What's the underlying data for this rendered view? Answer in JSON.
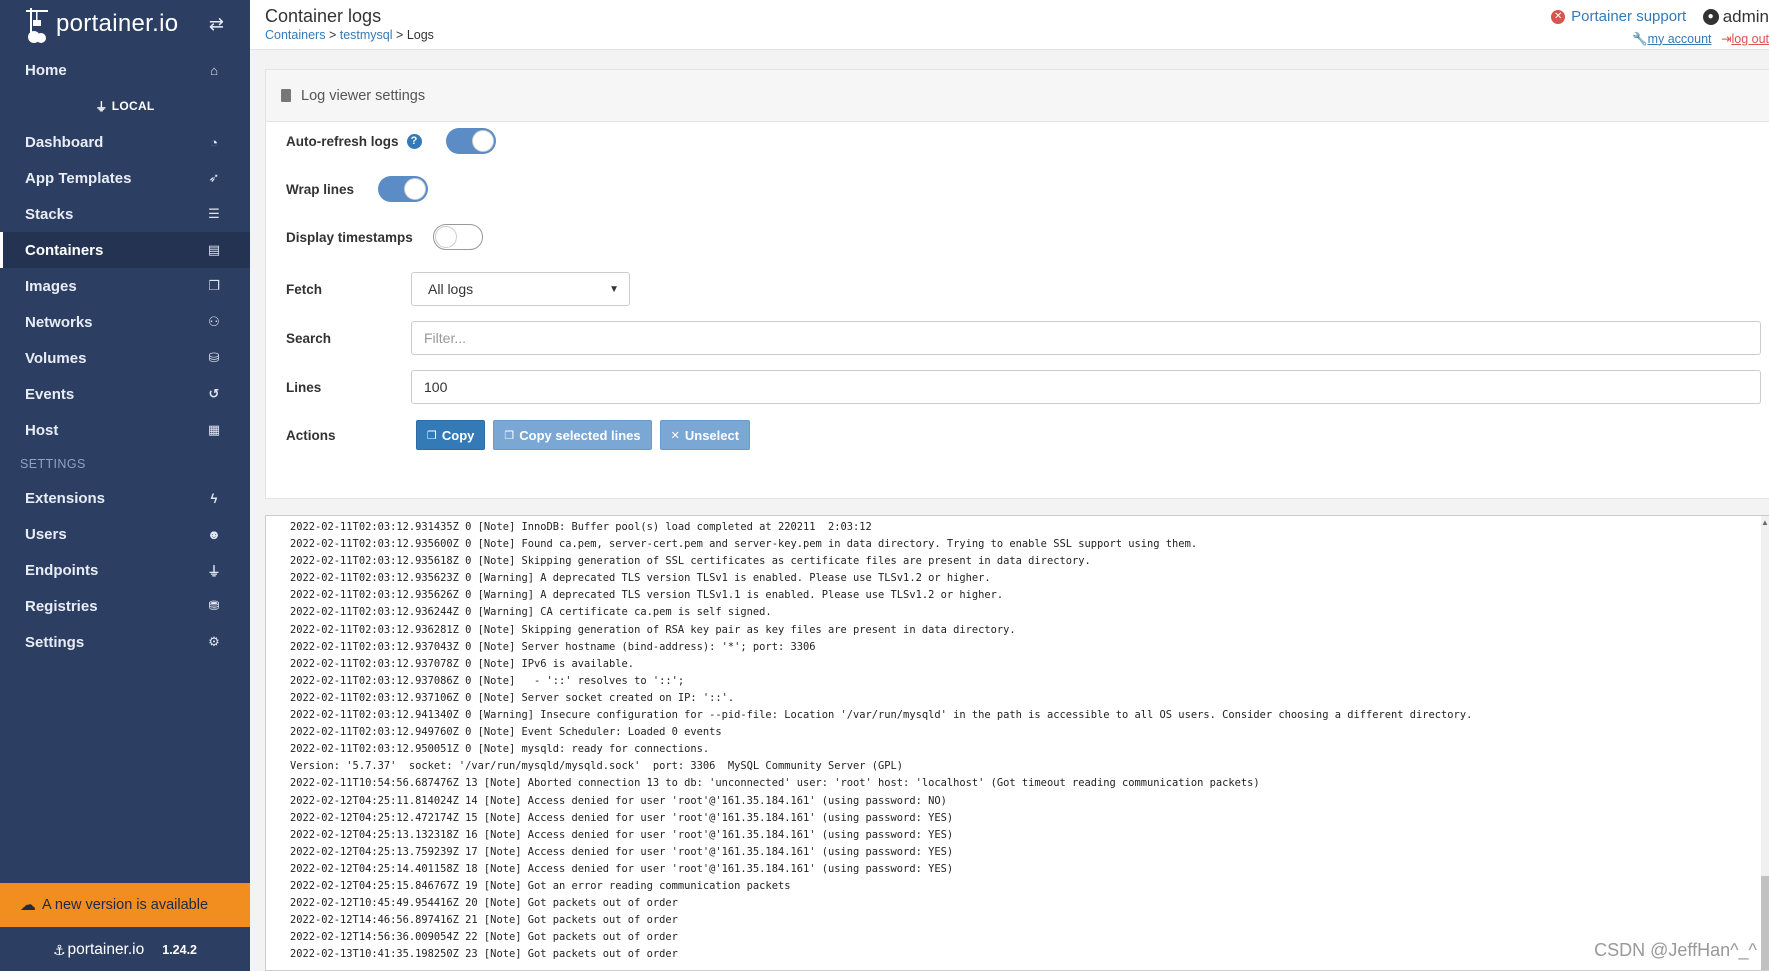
{
  "brand": {
    "name": "portainer.io",
    "version": "1.24.2"
  },
  "sidebar": {
    "home": "Home",
    "endpoint": "LOCAL",
    "items": [
      {
        "label": "Dashboard",
        "icon": "dashboard-icon"
      },
      {
        "label": "App Templates",
        "icon": "rocket-icon"
      },
      {
        "label": "Stacks",
        "icon": "list-icon"
      },
      {
        "label": "Containers",
        "icon": "server-icon"
      },
      {
        "label": "Images",
        "icon": "clone-icon"
      },
      {
        "label": "Networks",
        "icon": "sitemap-icon"
      },
      {
        "label": "Volumes",
        "icon": "cubes-icon"
      },
      {
        "label": "Events",
        "icon": "history-icon"
      },
      {
        "label": "Host",
        "icon": "th-icon"
      }
    ],
    "settings_header": "SETTINGS",
    "settings_items": [
      {
        "label": "Extensions",
        "icon": "bolt-icon"
      },
      {
        "label": "Users",
        "icon": "users-icon"
      },
      {
        "label": "Endpoints",
        "icon": "plug-icon"
      },
      {
        "label": "Registries",
        "icon": "database-icon"
      },
      {
        "label": "Settings",
        "icon": "cogs-icon"
      }
    ],
    "update_banner": "A new version is available"
  },
  "header": {
    "title": "Container logs",
    "breadcrumb": {
      "containers": "Containers",
      "container": "testmysql",
      "current": "Logs",
      "sep": ">"
    },
    "support": "Portainer support",
    "user": "admin",
    "my_account": "my account",
    "log_out": "log out"
  },
  "settings_panel": {
    "title": "Log viewer settings",
    "auto_refresh": {
      "label": "Auto-refresh logs",
      "on": true
    },
    "wrap_lines": {
      "label": "Wrap lines",
      "on": true
    },
    "timestamps": {
      "label": "Display timestamps",
      "on": false
    },
    "fetch": {
      "label": "Fetch",
      "value": "All logs"
    },
    "search": {
      "label": "Search",
      "placeholder": "Filter..."
    },
    "lines": {
      "label": "Lines",
      "value": "100"
    },
    "actions": {
      "label": "Actions",
      "copy": "Copy",
      "copy_selected": "Copy selected lines",
      "unselect": "Unselect"
    }
  },
  "logs": [
    "2022-02-11T02:03:12.931435Z 0 [Note] InnoDB: Buffer pool(s) load completed at 220211  2:03:12",
    "2022-02-11T02:03:12.935600Z 0 [Note] Found ca.pem, server-cert.pem and server-key.pem in data directory. Trying to enable SSL support using them.",
    "2022-02-11T02:03:12.935618Z 0 [Note] Skipping generation of SSL certificates as certificate files are present in data directory.",
    "2022-02-11T02:03:12.935623Z 0 [Warning] A deprecated TLS version TLSv1 is enabled. Please use TLSv1.2 or higher.",
    "2022-02-11T02:03:12.935626Z 0 [Warning] A deprecated TLS version TLSv1.1 is enabled. Please use TLSv1.2 or higher.",
    "2022-02-11T02:03:12.936244Z 0 [Warning] CA certificate ca.pem is self signed.",
    "2022-02-11T02:03:12.936281Z 0 [Note] Skipping generation of RSA key pair as key files are present in data directory.",
    "2022-02-11T02:03:12.937043Z 0 [Note] Server hostname (bind-address): '*'; port: 3306",
    "2022-02-11T02:03:12.937078Z 0 [Note] IPv6 is available.",
    "2022-02-11T02:03:12.937086Z 0 [Note]   - '::' resolves to '::';",
    "2022-02-11T02:03:12.937106Z 0 [Note] Server socket created on IP: '::'.",
    "2022-02-11T02:03:12.941340Z 0 [Warning] Insecure configuration for --pid-file: Location '/var/run/mysqld' in the path is accessible to all OS users. Consider choosing a different directory.",
    "2022-02-11T02:03:12.949760Z 0 [Note] Event Scheduler: Loaded 0 events",
    "2022-02-11T02:03:12.950051Z 0 [Note] mysqld: ready for connections.",
    "Version: '5.7.37'  socket: '/var/run/mysqld/mysqld.sock'  port: 3306  MySQL Community Server (GPL)",
    "2022-02-11T10:54:56.687476Z 13 [Note] Aborted connection 13 to db: 'unconnected' user: 'root' host: 'localhost' (Got timeout reading communication packets)",
    "2022-02-12T04:25:11.814024Z 14 [Note] Access denied for user 'root'@'161.35.184.161' (using password: NO)",
    "2022-02-12T04:25:12.472174Z 15 [Note] Access denied for user 'root'@'161.35.184.161' (using password: YES)",
    "2022-02-12T04:25:13.132318Z 16 [Note] Access denied for user 'root'@'161.35.184.161' (using password: YES)",
    "2022-02-12T04:25:13.759239Z 17 [Note] Access denied for user 'root'@'161.35.184.161' (using password: YES)",
    "2022-02-12T04:25:14.401158Z 18 [Note] Access denied for user 'root'@'161.35.184.161' (using password: YES)",
    "2022-02-12T04:25:15.846767Z 19 [Note] Got an error reading communication packets",
    "2022-02-12T10:45:49.954416Z 20 [Note] Got packets out of order",
    "2022-02-12T14:46:56.897416Z 21 [Note] Got packets out of order",
    "2022-02-12T14:56:36.009054Z 22 [Note] Got packets out of order",
    "2022-02-13T10:41:35.198250Z 23 [Note] Got packets out of order"
  ],
  "watermark": "CSDN @JeffHan^_^"
}
